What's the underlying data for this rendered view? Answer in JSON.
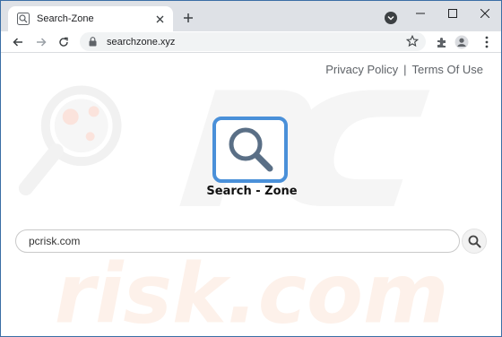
{
  "browser": {
    "tab": {
      "title": "Search-Zone",
      "favicon": "magnifier-favicon"
    },
    "new_tab_label": "+",
    "address": {
      "url": "searchzone.xyz"
    },
    "colors": {
      "tabstrip": "#dee1e6",
      "frame": "#3b6ea5"
    }
  },
  "page": {
    "top_links": {
      "privacy": "Privacy Policy",
      "separator": "|",
      "terms": "Terms Of Use"
    },
    "brand": "Search - Zone",
    "search": {
      "value": "pcrisk.com",
      "icon": "search-icon"
    },
    "colors": {
      "logo_border": "#4a90d9",
      "logo_glass": "#5a6f86"
    }
  }
}
